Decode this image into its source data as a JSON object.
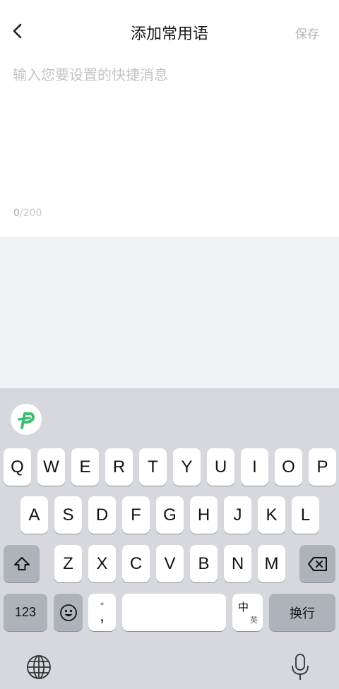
{
  "header": {
    "title": "添加常用语",
    "save_label": "保存"
  },
  "editor": {
    "placeholder": "输入您要设置的快捷消息",
    "value": "",
    "count_current": "0",
    "count_max": "/200"
  },
  "keyboard": {
    "row1": [
      "Q",
      "W",
      "E",
      "R",
      "T",
      "Y",
      "U",
      "I",
      "O",
      "P"
    ],
    "row2": [
      "A",
      "S",
      "D",
      "F",
      "G",
      "H",
      "J",
      "K",
      "L"
    ],
    "row3": [
      "Z",
      "X",
      "C",
      "V",
      "B",
      "N",
      "M"
    ],
    "numbers_label": "123",
    "punct_top": "°",
    "punct_bottom": ",",
    "lang_top": "中",
    "lang_bottom": "英",
    "return_label": "换行",
    "icons": {
      "back": "chevron-left-icon",
      "logo": "p-logo-icon",
      "shift": "shift-icon",
      "delete": "backspace-icon",
      "emoji": "emoji-icon",
      "globe": "globe-icon",
      "mic": "microphone-icon"
    }
  },
  "colors": {
    "accent_green": "#3dbf70",
    "keyboard_bg": "#d6d8de",
    "dark_key": "#aeb2bb"
  }
}
